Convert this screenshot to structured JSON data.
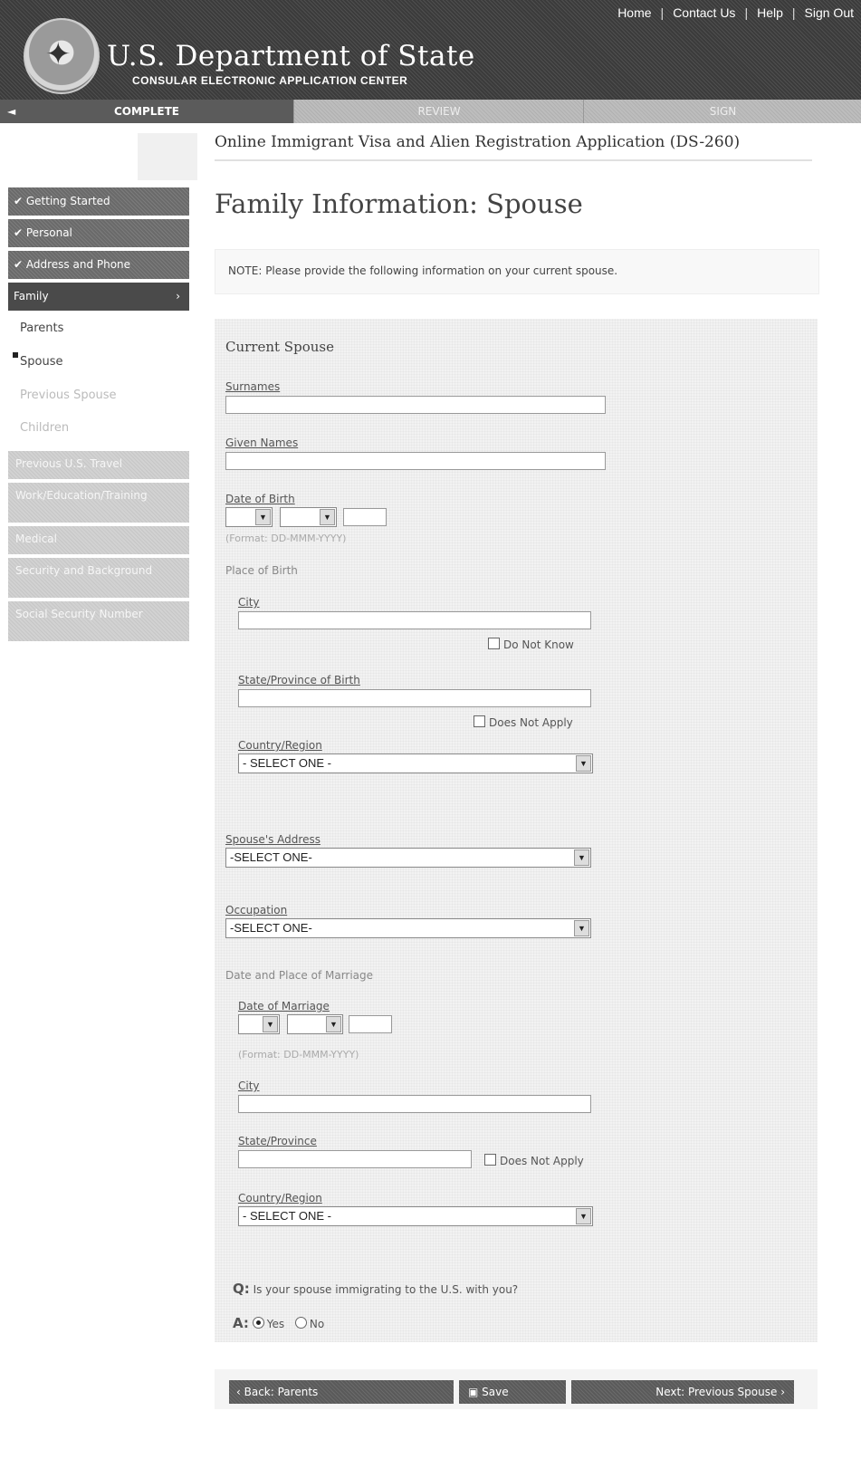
{
  "header": {
    "links": [
      "Home",
      "Contact Us",
      "Help",
      "Sign Out"
    ],
    "department": "U.S. Department of State",
    "subtitle": "CONSULAR ELECTRONIC APPLICATION CENTER"
  },
  "progress": {
    "complete": "COMPLETE",
    "review": "REVIEW",
    "sign": "SIGN"
  },
  "app_title": "Online Immigrant Visa and Alien Registration Application (DS-260)",
  "page_title": "Family Information: Spouse",
  "sidebar": {
    "done": [
      "Getting Started",
      "Personal",
      "Address and Phone"
    ],
    "active": "Family",
    "subitems": [
      "Parents",
      "Spouse",
      "Previous Spouse",
      "Children"
    ],
    "future": [
      "Previous U.S. Travel",
      "Work/Education/Training",
      "Medical",
      "Security and Background",
      "Social Security Number"
    ]
  },
  "note": "NOTE: Please provide the following information on your current spouse.",
  "form": {
    "section_title": "Current Spouse",
    "surnames_label": "Surnames",
    "given_names_label": "Given Names",
    "dob_label": "Date of Birth",
    "date_format": "(Format: DD-MMM-YYYY)",
    "pob_label": "Place of Birth",
    "city_label": "City",
    "do_not_know": "Do Not Know",
    "state_birth_label": "State/Province of Birth",
    "does_not_apply": "Does Not Apply",
    "country_label": "Country/Region",
    "select_one_spaced": "- SELECT ONE -",
    "select_one": "-SELECT ONE-",
    "address_label": "Spouse's Address",
    "occupation_label": "Occupation",
    "marriage_section": "Date and Place of Marriage",
    "dom_label": "Date of Marriage",
    "state_label": "State/Province",
    "question": "Is your spouse immigrating to the U.S. with you?",
    "q_prefix": "Q:",
    "a_prefix": "A:",
    "yes": "Yes",
    "no": "No",
    "selected_answer": "Yes"
  },
  "buttons": {
    "back": "‹ Back: Parents",
    "save": "Save",
    "next": "Next: Previous Spouse ›"
  }
}
